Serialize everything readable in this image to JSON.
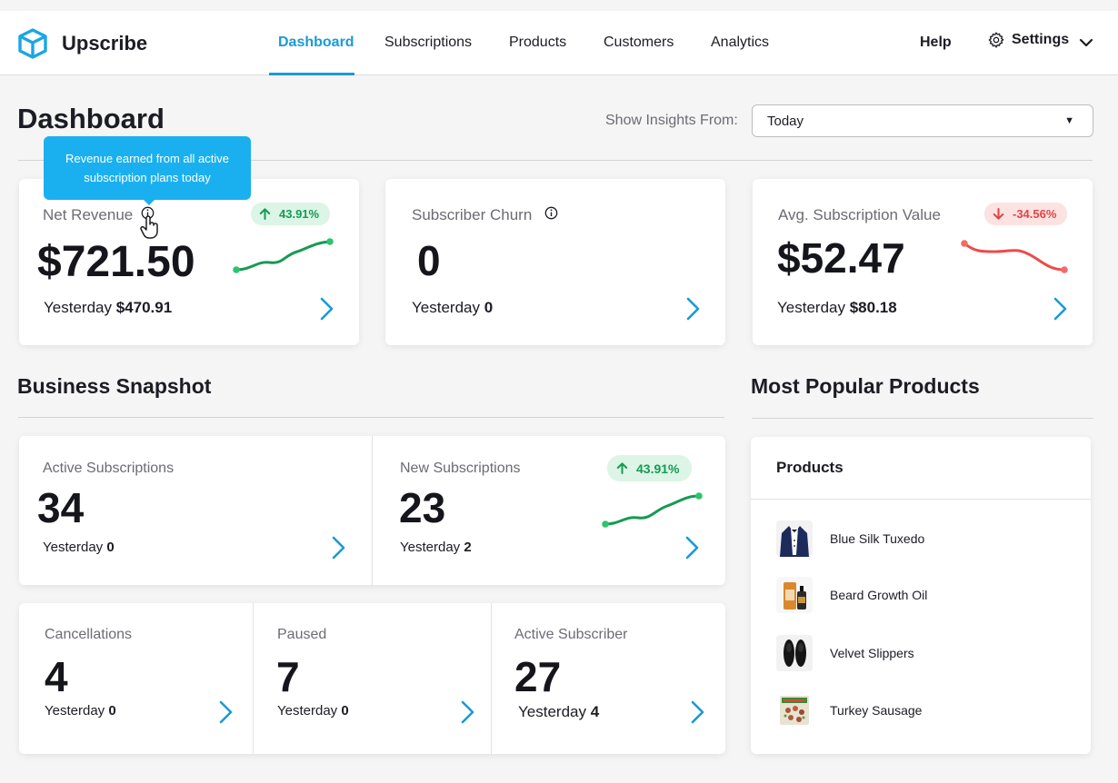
{
  "app": {
    "name": "Upscribe"
  },
  "nav": {
    "items": [
      {
        "label": "Dashboard",
        "active": true
      },
      {
        "label": "Subscriptions",
        "active": false
      },
      {
        "label": "Products",
        "active": false
      },
      {
        "label": "Customers",
        "active": false
      },
      {
        "label": "Analytics",
        "active": false
      }
    ],
    "help": "Help",
    "settings": "Settings"
  },
  "page": {
    "title": "Dashboard",
    "insights_label": "Show Insights From:",
    "insights_value": "Today"
  },
  "tooltip": {
    "text": "Revenue earned from all active subscription plans today"
  },
  "kpis": {
    "net_revenue": {
      "label": "Net Revenue",
      "value": "$721.50",
      "yesterday_prefix": "Yesterday",
      "yesterday_value": "$470.91",
      "change": "43.91%",
      "trend": "up"
    },
    "churn": {
      "label": "Subscriber Churn",
      "value": "0",
      "yesterday_prefix": "Yesterday",
      "yesterday_value": "0"
    },
    "avg_value": {
      "label": "Avg. Subscription Value",
      "value": "$52.47",
      "yesterday_prefix": "Yesterday",
      "yesterday_value": "$80.18",
      "change": "-34.56%",
      "trend": "down"
    }
  },
  "snapshot": {
    "title": "Business Snapshot",
    "active_subscriptions": {
      "label": "Active Subscriptions",
      "value": "34",
      "yesterday_prefix": "Yesterday",
      "yesterday_value": "0"
    },
    "new_subscriptions": {
      "label": "New Subscriptions",
      "value": "23",
      "yesterday_prefix": "Yesterday",
      "yesterday_value": "2",
      "change": "43.91%",
      "trend": "up"
    },
    "cancellations": {
      "label": "Cancellations",
      "value": "4",
      "yesterday_prefix": "Yesterday",
      "yesterday_value": "0"
    },
    "paused": {
      "label": "Paused",
      "value": "7",
      "yesterday_prefix": "Yesterday",
      "yesterday_value": "0"
    },
    "active_subscriber": {
      "label": "Active Subscriber",
      "value": "27",
      "yesterday_prefix": "Yesterday",
      "yesterday_value": "4"
    }
  },
  "popular": {
    "title": "Most Popular Products",
    "header": "Products",
    "items": [
      {
        "name": "Blue Silk Tuxedo",
        "icon": "tuxedo-thumbnail"
      },
      {
        "name": "Beard Growth Oil",
        "icon": "oil-bottle-thumbnail"
      },
      {
        "name": "Velvet Slippers",
        "icon": "slippers-thumbnail"
      },
      {
        "name": "Turkey Sausage",
        "icon": "sausage-package-thumbnail"
      }
    ]
  },
  "colors": {
    "accent": "#1a9ad6",
    "positive": "#169a54",
    "negative": "#e04444",
    "tooltip": "#1ab0ef"
  }
}
